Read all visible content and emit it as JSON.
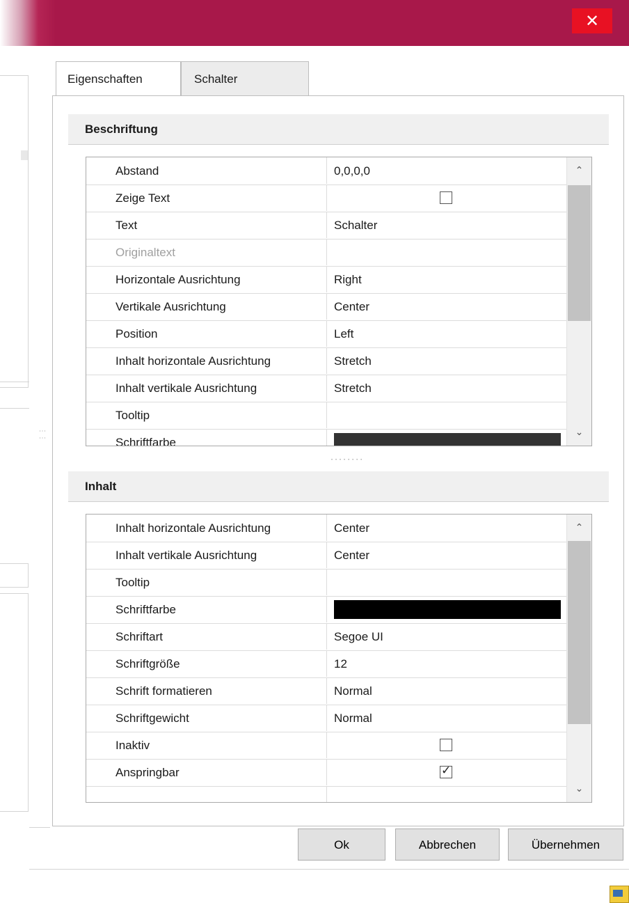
{
  "window": {
    "close_glyph": "✕",
    "accent_color": "#a8184a"
  },
  "tabs": [
    {
      "label": "Eigenschaften",
      "active": true
    },
    {
      "label": "Schalter",
      "active": false
    }
  ],
  "sections": {
    "beschriftung": {
      "title": "Beschriftung",
      "rows": [
        {
          "name": "Abstand",
          "value": "0,0,0,0"
        },
        {
          "name": "Zeige Text",
          "checkbox": false
        },
        {
          "name": "Text",
          "value": "Schalter"
        },
        {
          "name": "Originaltext",
          "value": "",
          "disabled": true
        },
        {
          "name": "Horizontale Ausrichtung",
          "value": "Right"
        },
        {
          "name": "Vertikale Ausrichtung",
          "value": "Center"
        },
        {
          "name": "Position",
          "value": "Left"
        },
        {
          "name": "Inhalt horizontale Ausrichtung",
          "value": "Stretch"
        },
        {
          "name": "Inhalt vertikale Ausrichtung",
          "value": "Stretch"
        },
        {
          "name": "Tooltip",
          "value": ""
        },
        {
          "name": "Schriftfarbe",
          "color": "#333333"
        }
      ]
    },
    "inhalt": {
      "title": "Inhalt",
      "rows": [
        {
          "name": "Inhalt horizontale Ausrichtung",
          "value": "Center"
        },
        {
          "name": "Inhalt vertikale Ausrichtung",
          "value": "Center"
        },
        {
          "name": "Tooltip",
          "value": ""
        },
        {
          "name": "Schriftfarbe",
          "color": "#000000"
        },
        {
          "name": "Schriftart",
          "value": "Segoe UI"
        },
        {
          "name": "Schriftgröße",
          "value": "12"
        },
        {
          "name": "Schrift formatieren",
          "value": "Normal"
        },
        {
          "name": "Schriftgewicht",
          "value": "Normal"
        },
        {
          "name": "Inaktiv",
          "checkbox": false
        },
        {
          "name": "Anspringbar",
          "checkbox": true
        }
      ]
    }
  },
  "scroll": {
    "up_glyph": "⌃",
    "down_glyph": "⌄"
  },
  "buttons": {
    "ok": "Ok",
    "cancel": "Abbrechen",
    "apply": "Übernehmen"
  }
}
